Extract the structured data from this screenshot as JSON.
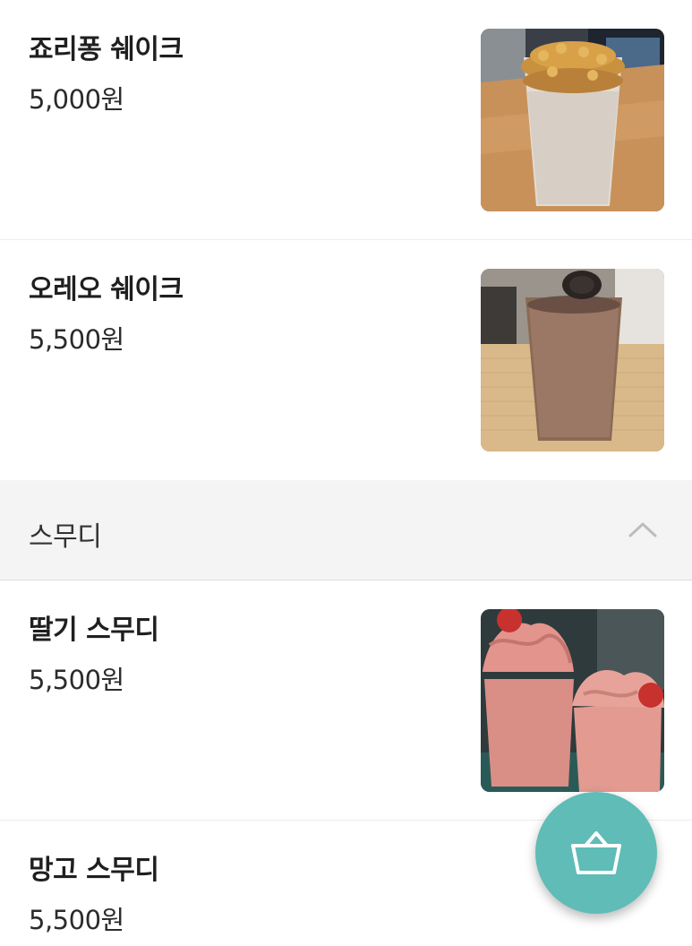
{
  "menu": {
    "items": [
      {
        "name": "죠리퐁 쉐이크",
        "price": "5,000원"
      },
      {
        "name": "오레오 쉐이크",
        "price": "5,500원"
      }
    ]
  },
  "category": {
    "label": "스무디",
    "expanded": true,
    "items": [
      {
        "name": "딸기 스무디",
        "price": "5,500원"
      },
      {
        "name": "망고 스무디",
        "price": "5,500원"
      }
    ]
  },
  "icons": {
    "collapse": "chevron-up-icon",
    "cart": "basket-icon"
  },
  "colors": {
    "accent": "#5fbcb7",
    "section_bg": "#f4f4f4",
    "divider": "#ececec"
  }
}
